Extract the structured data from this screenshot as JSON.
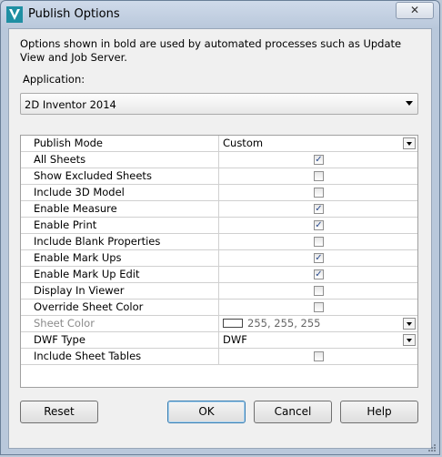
{
  "window": {
    "title": "Publish Options",
    "close_label": "✕"
  },
  "description": "Options shown in bold are used by automated processes such as Update View and Job Server.",
  "application": {
    "label": "Application:",
    "selected": "2D Inventor 2014"
  },
  "rows": [
    {
      "name": "Publish Mode",
      "type": "combo",
      "value": "Custom"
    },
    {
      "name": "All Sheets",
      "type": "checkbox",
      "checked": true
    },
    {
      "name": "Show Excluded Sheets",
      "type": "checkbox",
      "checked": false
    },
    {
      "name": "Include 3D Model",
      "type": "checkbox",
      "checked": false
    },
    {
      "name": "Enable Measure",
      "type": "checkbox",
      "checked": true
    },
    {
      "name": "Enable Print",
      "type": "checkbox",
      "checked": true
    },
    {
      "name": "Include Blank Properties",
      "type": "checkbox",
      "checked": false
    },
    {
      "name": "Enable Mark Ups",
      "type": "checkbox",
      "checked": true
    },
    {
      "name": "Enable Mark Up Edit",
      "type": "checkbox",
      "checked": true
    },
    {
      "name": "Display In Viewer",
      "type": "checkbox",
      "checked": false
    },
    {
      "name": "Override Sheet Color",
      "type": "checkbox",
      "checked": false
    },
    {
      "name": "Sheet Color",
      "type": "color",
      "value": "255, 255, 255",
      "disabled": true
    },
    {
      "name": "DWF Type",
      "type": "combo",
      "value": "DWF"
    },
    {
      "name": "Include Sheet Tables",
      "type": "checkbox",
      "checked": false
    }
  ],
  "buttons": {
    "reset": "Reset",
    "ok": "OK",
    "cancel": "Cancel",
    "help": "Help"
  },
  "colors": {
    "check": "#2a4b8d",
    "icon": "#1f8fa3"
  }
}
